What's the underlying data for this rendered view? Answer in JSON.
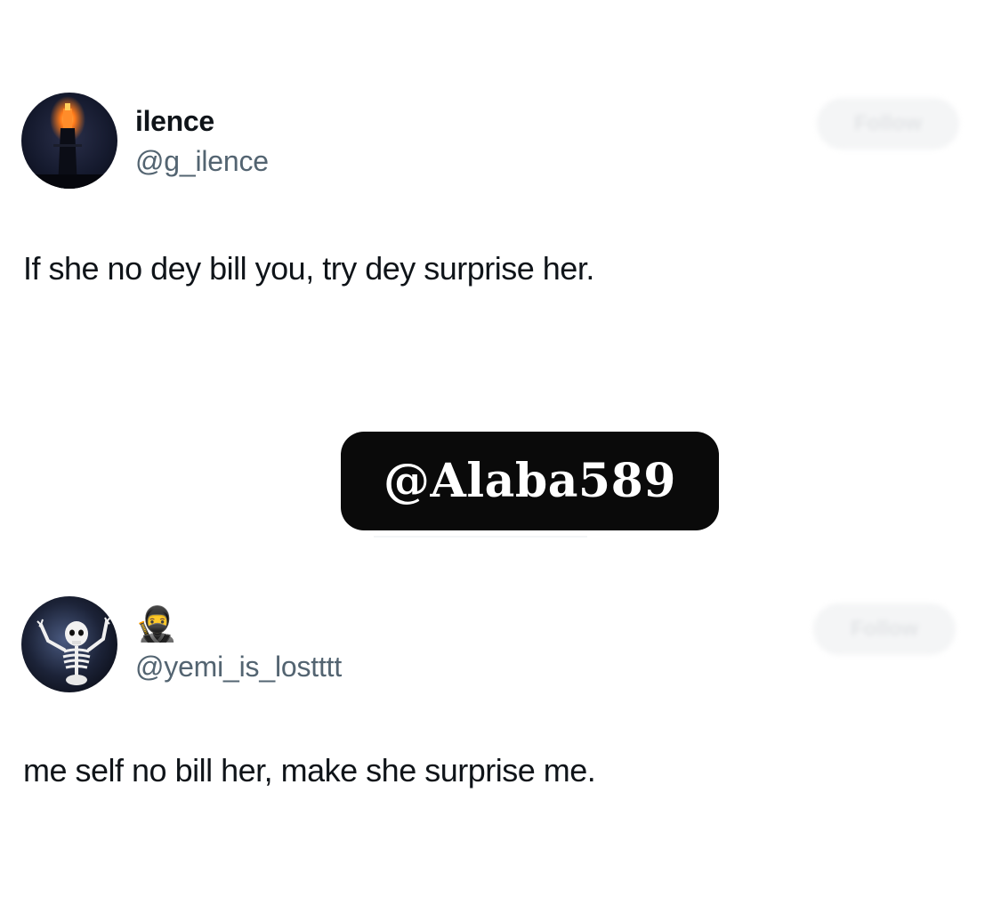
{
  "tweets": [
    {
      "display_name": "ilence",
      "handle": "@g_ilence",
      "follow_label": "Follow",
      "text": "If she no dey bill you, try dey surprise her.",
      "avatar_icon": "night-fire-tower-avatar"
    },
    {
      "display_name": "🥷",
      "handle": "@yemi_is_lostttt",
      "follow_label": "Follow",
      "text": "me self no bill her, make she surprise me.",
      "avatar_icon": "skeleton-avatar"
    }
  ],
  "watermark": {
    "text": "@Alaba589",
    "background": "#0a0a0a",
    "color": "#ffffff"
  },
  "colors": {
    "text_primary": "#0f1419",
    "text_secondary": "#536471"
  }
}
